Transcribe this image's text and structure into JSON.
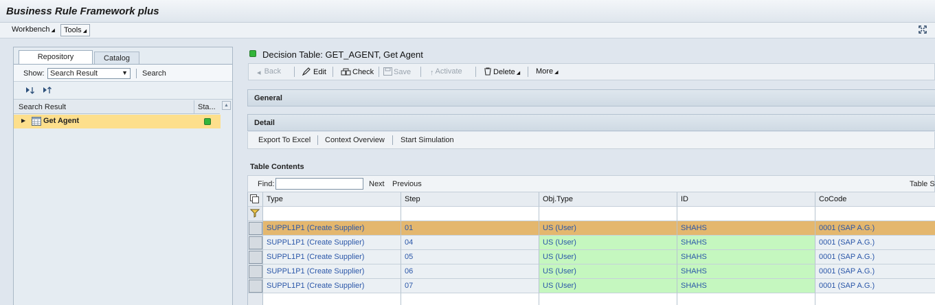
{
  "app": {
    "title": "Business Rule Framework plus"
  },
  "menu": {
    "workbench": "Workbench",
    "tools": "Tools"
  },
  "left": {
    "tabs": [
      "Repository",
      "Catalog"
    ],
    "show_label": "Show:",
    "show_value": "Search Result",
    "search_label": "Search",
    "columns": [
      "Search Result",
      "Sta..."
    ],
    "result": {
      "label": "Get Agent",
      "status_color": "#33b53a"
    }
  },
  "object": {
    "title": "Decision Table: GET_AGENT, Get Agent",
    "toolbar": {
      "back": "Back",
      "edit": "Edit",
      "check": "Check",
      "save": "Save",
      "activate": "Activate",
      "delete": "Delete",
      "more": "More"
    },
    "sections": {
      "general": "General",
      "detail": "Detail"
    },
    "detail_links": [
      "Export To Excel",
      "Context Overview",
      "Start Simulation"
    ]
  },
  "table": {
    "title": "Table Contents",
    "find_label": "Find:",
    "next": "Next",
    "previous": "Previous",
    "settings": "Table Settings",
    "columns": [
      "Type",
      "Step",
      "Obj.Type",
      "ID",
      "CoCode"
    ],
    "rows": [
      [
        "SUPPL1P1 (Create Supplier)",
        "01",
        "US (User)",
        "SHAHS",
        "0001 (SAP A.G.)"
      ],
      [
        "SUPPL1P1 (Create Supplier)",
        "04",
        "US (User)",
        "SHAHS",
        "0001 (SAP A.G.)"
      ],
      [
        "SUPPL1P1 (Create Supplier)",
        "05",
        "US (User)",
        "SHAHS",
        "0001 (SAP A.G.)"
      ],
      [
        "SUPPL1P1 (Create Supplier)",
        "06",
        "US (User)",
        "SHAHS",
        "0001 (SAP A.G.)"
      ],
      [
        "SUPPL1P1 (Create Supplier)",
        "07",
        "US (User)",
        "SHAHS",
        "0001 (SAP A.G.)"
      ]
    ],
    "colors": {
      "selected_row": "#e4b76e",
      "green_cell": "#c5f7bf"
    }
  }
}
